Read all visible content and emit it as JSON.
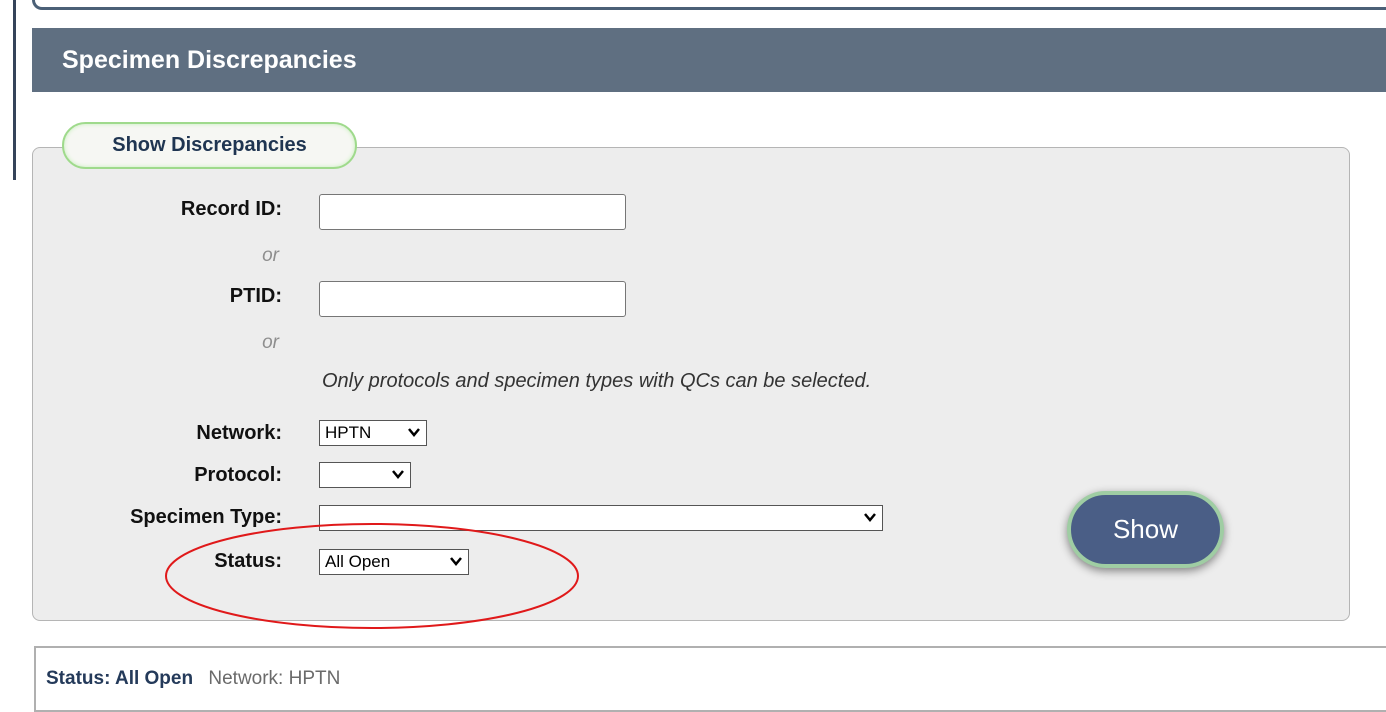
{
  "header": {
    "title": "Specimen Discrepancies"
  },
  "form": {
    "legend": "Show Discrepancies",
    "record_id_label": "Record ID:",
    "or_1": "or",
    "ptid_label": "PTID:",
    "or_2": "or",
    "note": "Only protocols and specimen types with QCs can be selected.",
    "network_label": "Network:",
    "network_value": "HPTN",
    "protocol_label": "Protocol:",
    "protocol_value": "",
    "specimen_type_label": "Specimen Type:",
    "specimen_type_value": "",
    "status_label": "Status:",
    "status_value": "All Open",
    "show_button": "Show"
  },
  "annotation": {
    "color": "#e0191a"
  },
  "status_bar": {
    "status_text": "Status: All Open",
    "network_text": "Network: HPTN"
  }
}
